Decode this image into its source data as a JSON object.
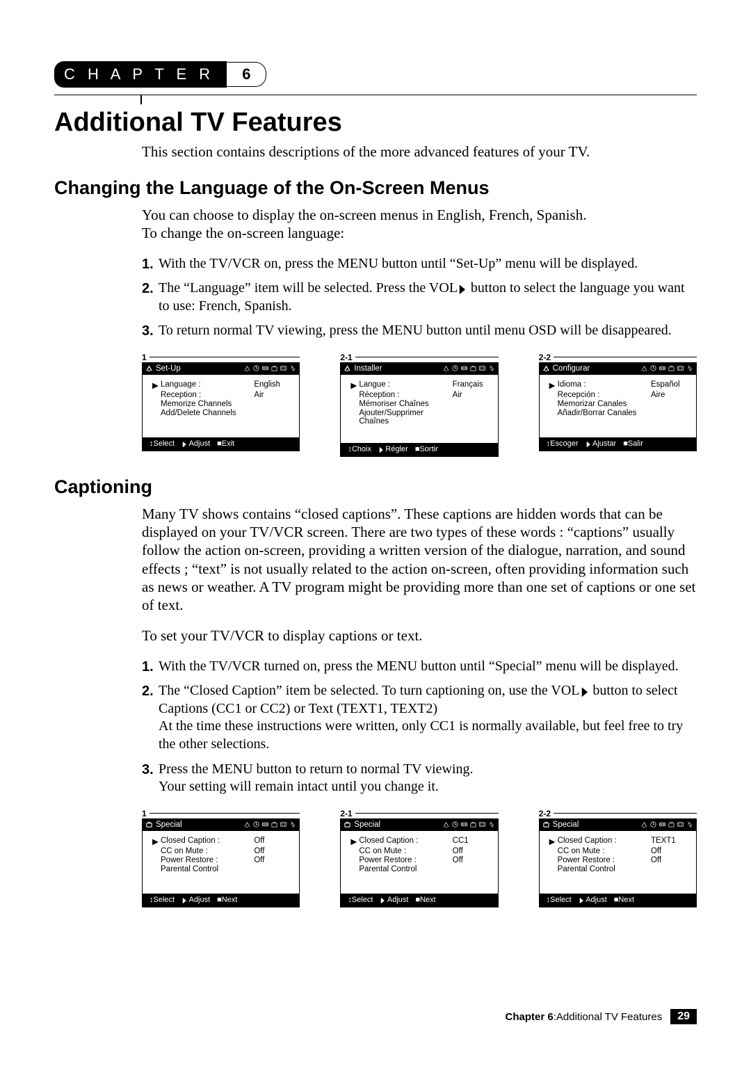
{
  "chapter_label": "C H A P T E R",
  "chapter_number": "6",
  "title": "Additional TV Features",
  "lead": "This section contains descriptions of the more advanced features of your TV.",
  "section1": {
    "heading": "Changing the Language of the On-Screen Menus",
    "intro1": "You can choose to display the on-screen menus in English, French, Spanish.",
    "intro2": "To change the on-screen language:",
    "steps": [
      "With the TV/VCR on, press the MENU button until “Set-Up” menu will be displayed.",
      "The “Language” item will be selected. Press the VOL▶ button to select the language you want to use: French, Spanish.",
      "To return normal TV viewing, press the MENU button until menu OSD will be disappeared."
    ],
    "panels": [
      {
        "label": "1",
        "title": "Set-Up",
        "rows": [
          {
            "arrow": "▶",
            "k": "Language :",
            "v": "English"
          },
          {
            "arrow": "",
            "k": "Reception :",
            "v": "Air"
          },
          {
            "arrow": "",
            "k": "Memorize Channels",
            "v": ""
          },
          {
            "arrow": "",
            "k": "Add/Delete Channels",
            "v": ""
          }
        ],
        "ftr": [
          "Select",
          "Adjust",
          "Exit"
        ]
      },
      {
        "label": "2-1",
        "title": "Installer",
        "rows": [
          {
            "arrow": "▶",
            "k": "Langue :",
            "v": "Français"
          },
          {
            "arrow": "",
            "k": "Réception :",
            "v": "Air"
          },
          {
            "arrow": "",
            "k": "Mémoriser Chaînes",
            "v": ""
          },
          {
            "arrow": "",
            "k": "Ajouter/Supprimer Chaînes",
            "v": ""
          }
        ],
        "ftr": [
          "Choix",
          "Régler",
          "Sortir"
        ]
      },
      {
        "label": "2-2",
        "title": "Configurar",
        "rows": [
          {
            "arrow": "▶",
            "k": "Idioma :",
            "v": "Español"
          },
          {
            "arrow": "",
            "k": "Recepción :",
            "v": "Aire"
          },
          {
            "arrow": "",
            "k": "Memorizar Canales",
            "v": ""
          },
          {
            "arrow": "",
            "k": "Añadir/Borrar Canales",
            "v": ""
          }
        ],
        "ftr": [
          "Escoger",
          "Ajustar",
          "Salir"
        ]
      }
    ]
  },
  "section2": {
    "heading": "Captioning",
    "para1": "Many TV shows contains “closed captions”. These captions are hidden words that can be displayed on your TV/VCR screen. There are two types of these words : “captions” usually follow the action on-screen, providing a written version of the dialogue, narration, and sound effects ; “text” is not usually related to the action on-screen, often providing information such as news or weather. A TV program might be providing more than one set of captions or one set of text.",
    "para2": "To set your TV/VCR to display captions or text.",
    "steps": [
      "With the TV/VCR turned on, press the MENU button until “Special” menu will be displayed.",
      "The “Closed Caption” item be selected. To turn captioning on, use the VOL▶ button to select Captions (CC1 or CC2) or Text (TEXT1, TEXT2)\nAt the time these instructions were written, only CC1 is normally available, but feel free to try the other selections.",
      "Press the MENU button to return to normal TV viewing.\nYour setting will remain intact until you change it."
    ],
    "panels": [
      {
        "label": "1",
        "title": "Special",
        "rows": [
          {
            "arrow": "▶",
            "k": "Closed Caption :",
            "v": "Off"
          },
          {
            "arrow": "",
            "k": "CC on Mute      :",
            "v": "Off"
          },
          {
            "arrow": "",
            "k": "Power Restore  :",
            "v": "Off"
          },
          {
            "arrow": "",
            "k": "Parental Control",
            "v": ""
          }
        ],
        "ftr": [
          "Select",
          "Adjust",
          "Next"
        ]
      },
      {
        "label": "2-1",
        "title": "Special",
        "rows": [
          {
            "arrow": "▶",
            "k": "Closed Caption :",
            "v": "CC1"
          },
          {
            "arrow": "",
            "k": "CC on Mute      :",
            "v": "Off"
          },
          {
            "arrow": "",
            "k": "Power Restore  :",
            "v": "Off"
          },
          {
            "arrow": "",
            "k": "Parental Control",
            "v": ""
          }
        ],
        "ftr": [
          "Select",
          "Adjust",
          "Next"
        ]
      },
      {
        "label": "2-2",
        "title": "Special",
        "rows": [
          {
            "arrow": "▶",
            "k": "Closed Caption :",
            "v": "TEXT1"
          },
          {
            "arrow": "",
            "k": "CC on Mute      :",
            "v": "Off"
          },
          {
            "arrow": "",
            "k": "Power Restore  :",
            "v": "Off"
          },
          {
            "arrow": "",
            "k": "Parental Control",
            "v": ""
          }
        ],
        "ftr": [
          "Select",
          "Adjust",
          "Next"
        ]
      }
    ]
  },
  "footer": {
    "chapter": "Chapter 6",
    "sep": " : ",
    "title": "Additional TV Features",
    "page": "29"
  },
  "glyph": {
    "updown": "↕",
    "rtri": "▶",
    "square": "■"
  }
}
